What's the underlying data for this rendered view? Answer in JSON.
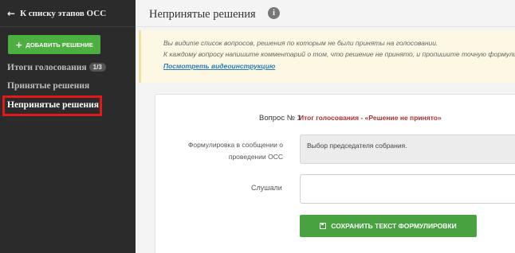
{
  "sidebar": {
    "back_label": "К списку этапов ОСС",
    "add_button_label": "ДОБАВИТЬ РЕШЕНИЕ",
    "items": [
      {
        "label": "Итоги голосования",
        "badge": "1/3"
      },
      {
        "label": "Принятые решения"
      },
      {
        "label": "Непринятые решения",
        "active": true
      }
    ]
  },
  "header": {
    "title": "Непринятые решения"
  },
  "notice": {
    "line1": "Вы видите список вопросов, решения по которым не были приняты на голосовании.",
    "line2": "К каждому вопросу напишите комментарий о том, что решение не принято, и пропишите точную формулировку",
    "link_label": "Посмотреть видеоинструкцию"
  },
  "question": {
    "label": "Вопрос № 1",
    "result": "Итог голосования - «Решение не принято»",
    "formulation_label": "Формулировка в сообщении о проведении ОСС",
    "formulation_value": "Выбор председателя собрания.",
    "heard_label": "Слушали",
    "heard_value": "",
    "save_label": "СОХРАНИТЬ ТЕКСТ ФОРМУЛИРОВКИ"
  },
  "colors": {
    "sidebar_bg": "#2b2b2b",
    "accent_green": "#4caf3f",
    "result_red": "#a83232",
    "highlight": "#e01a1a",
    "link_blue": "#2a7bb8",
    "notice_bg": "#fcf8e3"
  }
}
